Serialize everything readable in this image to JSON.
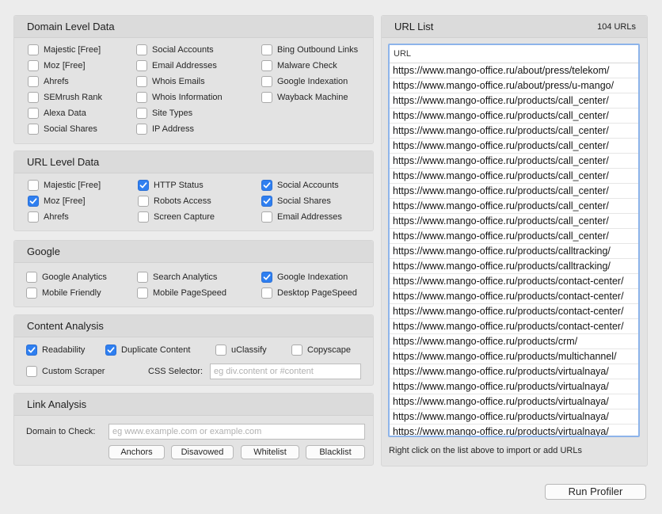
{
  "domain_level": {
    "title": "Domain Level Data",
    "items": [
      {
        "label": "Majestic [Free]",
        "checked": false
      },
      {
        "label": "Moz [Free]",
        "checked": false
      },
      {
        "label": "Ahrefs",
        "checked": false
      },
      {
        "label": "SEMrush Rank",
        "checked": false
      },
      {
        "label": "Alexa Data",
        "checked": false
      },
      {
        "label": "Social Shares",
        "checked": false
      },
      {
        "label": "Social Accounts",
        "checked": false
      },
      {
        "label": "Email Addresses",
        "checked": false
      },
      {
        "label": "Whois Emails",
        "checked": false
      },
      {
        "label": "Whois Information",
        "checked": false
      },
      {
        "label": "Site Types",
        "checked": false
      },
      {
        "label": "IP Address",
        "checked": false
      },
      {
        "label": "Bing Outbound Links",
        "checked": false
      },
      {
        "label": "Malware Check",
        "checked": false
      },
      {
        "label": "Google Indexation",
        "checked": false
      },
      {
        "label": "Wayback Machine",
        "checked": false
      }
    ]
  },
  "url_level": {
    "title": "URL Level Data",
    "items": [
      {
        "label": "Majestic [Free]",
        "checked": false
      },
      {
        "label": "Moz [Free]",
        "checked": true
      },
      {
        "label": "Ahrefs",
        "checked": false
      },
      {
        "label": "HTTP Status",
        "checked": true
      },
      {
        "label": "Robots Access",
        "checked": false
      },
      {
        "label": "Screen Capture",
        "checked": false
      },
      {
        "label": "Social Accounts",
        "checked": true
      },
      {
        "label": "Social Shares",
        "checked": true
      },
      {
        "label": "Email Addresses",
        "checked": false
      }
    ]
  },
  "google": {
    "title": "Google",
    "items": [
      {
        "label": "Google Analytics",
        "checked": false
      },
      {
        "label": "Mobile Friendly",
        "checked": false
      },
      {
        "label": "Search Analytics",
        "checked": false
      },
      {
        "label": "Mobile PageSpeed",
        "checked": false
      },
      {
        "label": "Google Indexation",
        "checked": true
      },
      {
        "label": "Desktop PageSpeed",
        "checked": false
      }
    ]
  },
  "content_analysis": {
    "title": "Content Analysis",
    "items": [
      {
        "label": "Readability",
        "checked": true
      },
      {
        "label": "Duplicate Content",
        "checked": true
      },
      {
        "label": "uClassify",
        "checked": false
      },
      {
        "label": "Copyscape",
        "checked": false
      },
      {
        "label": "Custom Scraper",
        "checked": false
      }
    ],
    "css_selector_label": "CSS Selector:",
    "css_selector_placeholder": "eg div.content or #content",
    "css_selector_value": ""
  },
  "link_analysis": {
    "title": "Link Analysis",
    "domain_label": "Domain to Check:",
    "domain_placeholder": "eg www.example.com or example.com",
    "domain_value": "",
    "buttons": [
      "Anchors",
      "Disavowed",
      "Whitelist",
      "Blacklist"
    ]
  },
  "url_list": {
    "title": "URL List",
    "count": "104 URLs",
    "column_header": "URL",
    "hint": "Right click on the list above to import or add URLs",
    "rows": [
      "https://www.mango-office.ru/about/press/telekom/",
      "https://www.mango-office.ru/about/press/u-mango/",
      "https://www.mango-office.ru/products/call_center/",
      "https://www.mango-office.ru/products/call_center/",
      "https://www.mango-office.ru/products/call_center/",
      "https://www.mango-office.ru/products/call_center/",
      "https://www.mango-office.ru/products/call_center/",
      "https://www.mango-office.ru/products/call_center/",
      "https://www.mango-office.ru/products/call_center/",
      "https://www.mango-office.ru/products/call_center/",
      "https://www.mango-office.ru/products/call_center/",
      "https://www.mango-office.ru/products/call_center/",
      "https://www.mango-office.ru/products/calltracking/",
      "https://www.mango-office.ru/products/calltracking/",
      "https://www.mango-office.ru/products/contact-center/",
      "https://www.mango-office.ru/products/contact-center/",
      "https://www.mango-office.ru/products/contact-center/",
      "https://www.mango-office.ru/products/contact-center/",
      "https://www.mango-office.ru/products/crm/",
      "https://www.mango-office.ru/products/multichannel/",
      "https://www.mango-office.ru/products/virtualnaya/",
      "https://www.mango-office.ru/products/virtualnaya/",
      "https://www.mango-office.ru/products/virtualnaya/",
      "https://www.mango-office.ru/products/virtualnaya/",
      "https://www.mango-office.ru/products/virtualnaya/"
    ]
  },
  "run_button": "Run Profiler"
}
